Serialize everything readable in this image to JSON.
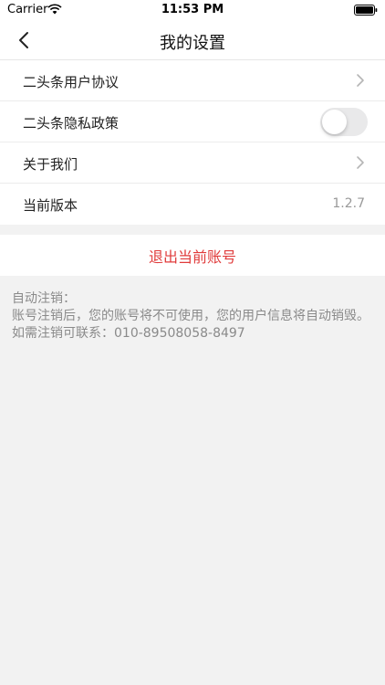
{
  "status_bar": {
    "carrier": "Carrier",
    "time": "11:53 PM"
  },
  "nav": {
    "title": "我的设置"
  },
  "settings": {
    "items": [
      {
        "label": "二头条用户协议",
        "type": "link"
      },
      {
        "label": "二头条隐私政策",
        "type": "toggle",
        "value": "off"
      },
      {
        "label": "关于我们",
        "type": "link"
      },
      {
        "label": "当前版本",
        "type": "value",
        "value": "1.2.7"
      }
    ]
  },
  "logout": {
    "label": "退出当前账号"
  },
  "notice": {
    "title": "自动注销：",
    "body": "账号注销后，您的账号将不可使用，您的用户信息将自动销毁。如需注销可联系：010-89508058-8497"
  },
  "colors": {
    "accent_red": "#e03c3c",
    "toggle_off": "#e9e9ea",
    "background": "#f2f2f2"
  }
}
